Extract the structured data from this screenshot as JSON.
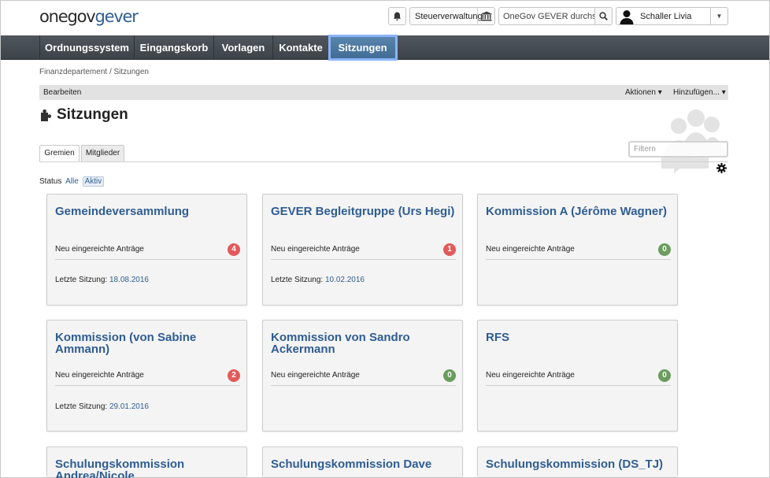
{
  "header": {
    "logo_part1": "onegov",
    "logo_part2": "gever",
    "org_unit": "Steuerverwaltung",
    "search_placeholder": "OneGov GEVER durchsuchen",
    "user_name": "Schaller Livia"
  },
  "nav": {
    "items": [
      {
        "label": "Ordnungssystem"
      },
      {
        "label": "Eingangskorb"
      },
      {
        "label": "Vorlagen"
      },
      {
        "label": "Kontakte"
      },
      {
        "label": "Sitzungen"
      }
    ],
    "active_index": 4
  },
  "breadcrumb": "Finanzdepartement / Sitzungen",
  "actionbar": {
    "edit": "Bearbeiten",
    "actions": "Aktionen ▾",
    "add": "Hinzufügen... ▾"
  },
  "page": {
    "title": "Sitzungen"
  },
  "tabs": [
    {
      "label": "Gremien",
      "active": true
    },
    {
      "label": "Mitglieder",
      "active": false
    }
  ],
  "filter": {
    "placeholder": "Filtern"
  },
  "status_filter": {
    "label": "Status",
    "all": "Alle",
    "active": "Aktiv"
  },
  "card_labels": {
    "proposals": "Neu eingereichte Anträge",
    "last_meeting": "Letzte Sitzung:"
  },
  "committees": [
    {
      "title": "Gemeindeversammlung",
      "count": "4",
      "status": "red",
      "last_date": "18.08.2016"
    },
    {
      "title": "GEVER Begleitgruppe (Urs Hegi)",
      "count": "1",
      "status": "red",
      "last_date": "10.02.2016"
    },
    {
      "title": "Kommission A (Jérôme Wagner)",
      "count": "0",
      "status": "green",
      "last_date": ""
    },
    {
      "title": "Kommission (von Sabine Ammann)",
      "count": "2",
      "status": "red",
      "last_date": "29.01.2016"
    },
    {
      "title": "Kommission von Sandro Ackermann",
      "count": "0",
      "status": "green",
      "last_date": ""
    },
    {
      "title": "RFS",
      "count": "0",
      "status": "green",
      "last_date": ""
    },
    {
      "title": "Schulungskommission Andrea/Nicole",
      "count": "",
      "status": "",
      "last_date": ""
    },
    {
      "title": "Schulungskommission Dave",
      "count": "",
      "status": "",
      "last_date": ""
    },
    {
      "title": "Schulungskommission (DS_TJ)",
      "count": "",
      "status": "",
      "last_date": ""
    }
  ],
  "colors": {
    "nav_bg": "#474e55",
    "nav_active": "#4a76a0",
    "link": "#2f5d93",
    "badge_red": "#e25a5a",
    "badge_green": "#6b9c5e"
  }
}
